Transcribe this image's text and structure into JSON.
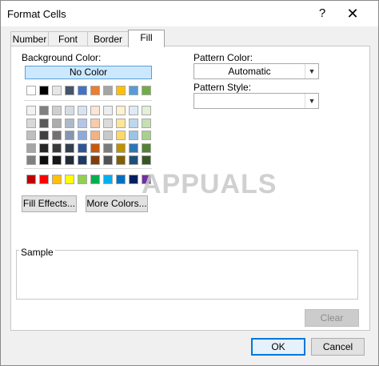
{
  "window": {
    "title": "Format Cells",
    "help_glyph": "?",
    "close_glyph": "✕"
  },
  "tabs": [
    {
      "label": "Number"
    },
    {
      "label": "Font"
    },
    {
      "label": "Border"
    },
    {
      "label": "Fill",
      "active": true
    }
  ],
  "fill": {
    "background_color_label": "Background Color:",
    "no_color_label": "No Color",
    "theme_top_row": [
      "#ffffff",
      "#000000",
      "#e7e6e6",
      "#44546a",
      "#4472c4",
      "#ed7d31",
      "#a5a5a5",
      "#ffc000",
      "#5b9bd5",
      "#70ad47"
    ],
    "theme_shades": [
      [
        "#f2f2f2",
        "#808080",
        "#d0cece",
        "#d6dce4",
        "#d9e2f3",
        "#fbe5d5",
        "#ededed",
        "#fff2cc",
        "#deebf6",
        "#e2efd9"
      ],
      [
        "#d9d9d9",
        "#595959",
        "#aeabab",
        "#adb9ca",
        "#b4c6e7",
        "#f7cbac",
        "#dbdbdb",
        "#fee599",
        "#bdd7ee",
        "#c5e0b3"
      ],
      [
        "#bfbfbf",
        "#404040",
        "#747070",
        "#8496b0",
        "#8eaadb",
        "#f4b183",
        "#c9c9c9",
        "#ffd965",
        "#9cc3e5",
        "#a8d08d"
      ],
      [
        "#a6a6a6",
        "#262626",
        "#3a3838",
        "#323f4f",
        "#2f5496",
        "#c55a11",
        "#7b7b7b",
        "#bf9000",
        "#2e75b5",
        "#538135"
      ],
      [
        "#808080",
        "#0d0d0d",
        "#171616",
        "#222a35",
        "#1f3864",
        "#833c0b",
        "#525252",
        "#7f6000",
        "#1f4e79",
        "#375623"
      ]
    ],
    "standard_colors": [
      "#c00000",
      "#ff0000",
      "#ffc000",
      "#ffff00",
      "#92d050",
      "#00b050",
      "#00b0f0",
      "#0070c0",
      "#002060",
      "#7030a0"
    ],
    "fill_effects_label": "Fill Effects...",
    "more_colors_label": "More Colors...",
    "pattern_color_label": "Pattern Color:",
    "pattern_color_value": "Automatic",
    "pattern_style_label": "Pattern Style:",
    "pattern_style_value": ""
  },
  "sample": {
    "label": "Sample"
  },
  "buttons": {
    "clear": "Clear",
    "ok": "OK",
    "cancel": "Cancel"
  },
  "watermark": {
    "text": "APPUALS"
  }
}
